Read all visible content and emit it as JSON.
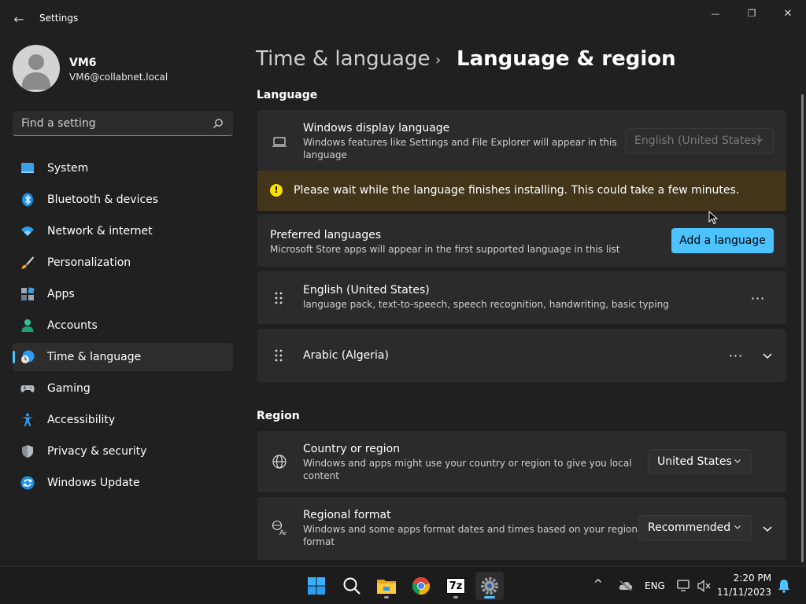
{
  "window": {
    "title": "Settings",
    "minimize_glyph": "—",
    "maximize_glyph": "❐",
    "close_glyph": "✕",
    "back_glyph": "←"
  },
  "user": {
    "name": "VM6",
    "email": "VM6@collabnet.local"
  },
  "search": {
    "placeholder": "Find a setting"
  },
  "sidebar": {
    "items": [
      {
        "label": "System",
        "icon": "system-icon"
      },
      {
        "label": "Bluetooth & devices",
        "icon": "bluetooth-icon"
      },
      {
        "label": "Network & internet",
        "icon": "wifi-icon"
      },
      {
        "label": "Personalization",
        "icon": "brush-icon"
      },
      {
        "label": "Apps",
        "icon": "apps-icon"
      },
      {
        "label": "Accounts",
        "icon": "person-icon"
      },
      {
        "label": "Time & language",
        "icon": "clock-globe-icon",
        "active": true
      },
      {
        "label": "Gaming",
        "icon": "gamepad-icon"
      },
      {
        "label": "Accessibility",
        "icon": "accessibility-icon"
      },
      {
        "label": "Privacy & security",
        "icon": "shield-icon"
      },
      {
        "label": "Windows Update",
        "icon": "update-icon"
      }
    ]
  },
  "breadcrumb": {
    "parent": "Time & language",
    "separator": "›",
    "current": "Language & region"
  },
  "language": {
    "section_title": "Language",
    "display_language": {
      "title": "Windows display language",
      "desc_line1": "Windows features like Settings and File Explorer will appear in this",
      "desc_line2": "language",
      "value": "English (United States)"
    },
    "warning": {
      "icon_glyph": "!",
      "text": "Please wait while the language finishes installing. This could take a few minutes."
    },
    "preferred": {
      "title": "Preferred languages",
      "desc": "Microsoft Store apps will appear in the first supported language in this list",
      "add_button": "Add a language"
    },
    "languages": [
      {
        "name": "English (United States)",
        "features": "language pack, text-to-speech, speech recognition, handwriting, basic typing"
      },
      {
        "name": "Arabic (Algeria)",
        "features": ""
      }
    ],
    "more_glyph": "···"
  },
  "region": {
    "section_title": "Region",
    "country": {
      "title": "Country or region",
      "desc_line1": "Windows and apps might use your country or region to give you local",
      "desc_line2": "content",
      "value": "United States"
    },
    "format": {
      "title": "Regional format",
      "desc_line1": "Windows and some apps format dates and times based on your regional",
      "desc_line2": "format",
      "value": "Recommended"
    }
  },
  "taskbar": {
    "apps": [
      "start-icon",
      "search-icon",
      "file-explorer-icon",
      "chrome-icon",
      "7zip-icon",
      "settings-icon"
    ],
    "sevenzip_label": "7z",
    "tray": {
      "chevron": "^",
      "language": "ENG",
      "time": "2:20 PM",
      "date": "11/11/2023"
    }
  },
  "colors": {
    "accent": "#4cc2ff",
    "warning_bg": "#433519",
    "warning_icon": "#fce100",
    "card_bg": "#2b2b2b",
    "window_bg": "#202020"
  }
}
